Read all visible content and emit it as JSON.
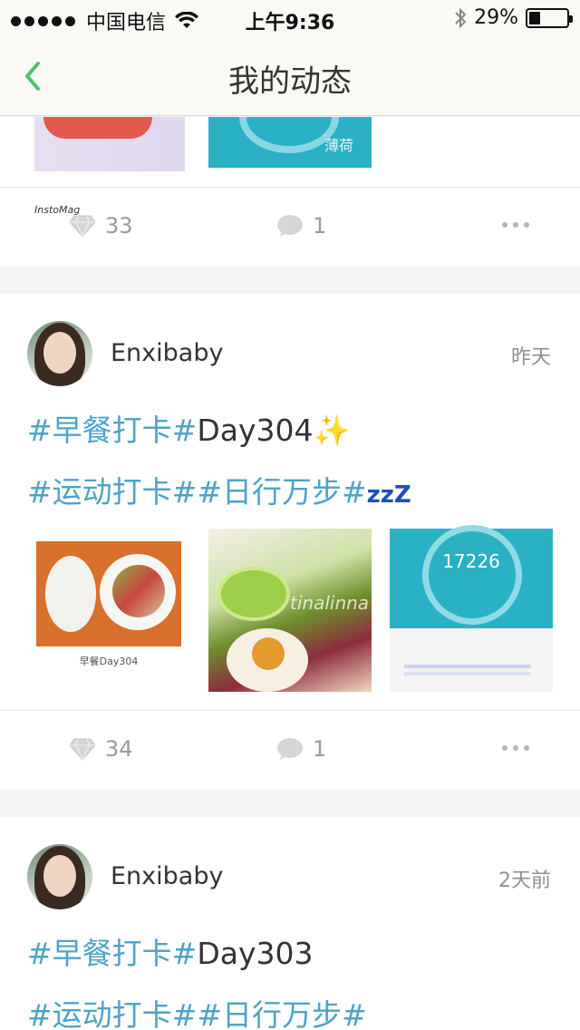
{
  "status_bar": {
    "carrier": "中国电信",
    "time": "上午9:36",
    "battery": "29%",
    "battery_level": 0.29
  },
  "nav": {
    "title": "我的动态"
  },
  "posts": [
    {
      "gem_count": "33",
      "comment_count": "1",
      "thumb_captions": [
        "InstoMag",
        "薄荷"
      ]
    },
    {
      "username": "Enxibaby",
      "time": "昨天",
      "line1_tags": [
        "#早餐打卡#"
      ],
      "line1_text": "Day304",
      "line1_emoji": "✨",
      "line2_tags": [
        "#运动打卡#",
        "#日行万步#"
      ],
      "line2_emoji": "zzZ",
      "thumb_labels": [
        "早餐Day304",
        "tinalinna",
        "17226"
      ],
      "gem_count": "34",
      "comment_count": "1"
    },
    {
      "username": "Enxibaby",
      "time": "2天前",
      "line1_tags": [
        "#早餐打卡#"
      ],
      "line1_text": "Day303",
      "line2_tags": [
        "#运动打卡#",
        "#日行万步#"
      ]
    }
  ],
  "colors": {
    "tag": "#4ea3c8",
    "accent_green": "#4cc26b"
  },
  "icons": [
    "back-chevron-icon",
    "wifi-icon",
    "bluetooth-icon",
    "battery-icon",
    "gem-icon",
    "comment-icon",
    "more-icon"
  ]
}
